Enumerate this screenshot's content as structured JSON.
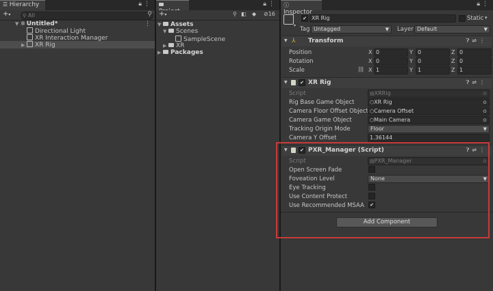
{
  "hierarchy": {
    "tab_label": "Hierarchy",
    "search_placeholder": "All",
    "scene_name": "Untitled*",
    "items": [
      {
        "label": "Directional Light"
      },
      {
        "label": "XR Interaction Manager"
      },
      {
        "label": "XR Rig"
      }
    ]
  },
  "project": {
    "tab_label": "Project",
    "hidden_count": "16",
    "tree": {
      "assets": "Assets",
      "scenes": "Scenes",
      "sample_scene": "SampleScene",
      "xr": "XR",
      "packages": "Packages"
    }
  },
  "inspector": {
    "tab_label": "Inspector",
    "object_name": "XR Rig",
    "static_label": "Static",
    "tag_label": "Tag",
    "tag_value": "Untagged",
    "layer_label": "Layer",
    "layer_value": "Default",
    "transform": {
      "title": "Transform",
      "rows": [
        {
          "label": "Position",
          "x": "0",
          "y": "0",
          "z": "0"
        },
        {
          "label": "Rotation",
          "x": "0",
          "y": "0",
          "z": "0"
        },
        {
          "label": "Scale",
          "x": "1",
          "y": "1",
          "z": "1"
        }
      ],
      "axis_x": "X",
      "axis_y": "Y",
      "axis_z": "Z"
    },
    "xrrig": {
      "title": "XR Rig",
      "script_label": "Script",
      "script_value": "XRRig",
      "rig_base_label": "Rig Base Game Object",
      "rig_base_value": "XR Rig",
      "cam_floor_label": "Camera Floor Offset Object",
      "cam_floor_value": "Camera Offset",
      "cam_go_label": "Camera Game Object",
      "cam_go_value": "Main Camera",
      "tracking_label": "Tracking Origin Mode",
      "tracking_value": "Floor",
      "cam_y_label": "Camera Y Offset",
      "cam_y_value": "1.36144"
    },
    "pxr": {
      "title": "PXR_Manager (Script)",
      "script_label": "Script",
      "script_value": "PXR_Manager",
      "open_fade_label": "Open Screen Fade",
      "foveation_label": "Foveation Level",
      "foveation_value": "None",
      "eye_tracking_label": "Eye Tracking",
      "content_protect_label": "Use Content Protect",
      "msaa_label": "Use Recommended MSAA",
      "msaa_checked": true
    },
    "add_component": "Add Component"
  },
  "colors": {
    "highlight_border": "#c83a3a",
    "panel_bg": "#383838",
    "selection": "#4d4d4d"
  }
}
